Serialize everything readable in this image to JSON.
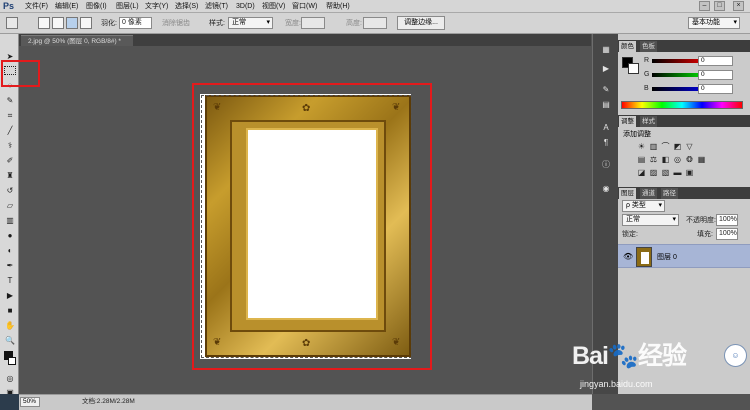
{
  "menubar": {
    "logo": "Ps",
    "items": [
      "文件(F)",
      "编辑(E)",
      "图像(I)",
      "图层(L)",
      "文字(Y)",
      "选择(S)",
      "滤镜(T)",
      "3D(D)",
      "视图(V)",
      "窗口(W)",
      "帮助(H)"
    ],
    "window_controls": [
      "–",
      "□",
      "×"
    ]
  },
  "options": {
    "feather_label": "羽化:",
    "feather_value": "0 像素",
    "antialias_label": "消除锯齿",
    "style_label": "样式:",
    "style_value": "正常",
    "width_label": "宽度:",
    "height_label": "高度:",
    "refine_button": "调整边缘...",
    "workspace_value": "基本功能"
  },
  "document": {
    "tab_label": "2.jpg @ 50% (图层 0, RGB/8#) *"
  },
  "status": {
    "zoom": "50%",
    "doc_info": "文档:2.28M/2.28M"
  },
  "panels": {
    "color_tabs": [
      "颜色",
      "色板"
    ],
    "channel_labels": [
      "R",
      "G",
      "B"
    ],
    "channel_values": [
      "0",
      "0",
      "0"
    ],
    "adjustments_tabs": [
      "调整",
      "样式"
    ],
    "adjustments_title": "添加调整",
    "layers_tabs": [
      "图层",
      "通道",
      "路径"
    ],
    "kind_label": "ρ 类型",
    "blend_mode": "正常",
    "opacity_label": "不透明度:",
    "opacity_value": "100%",
    "lock_label": "锁定:",
    "fill_label": "填充:",
    "fill_value": "100%",
    "layer_name": "图层 0"
  },
  "watermark": {
    "brand": "Bai🐾经验",
    "url": "jingyan.baidu.com"
  },
  "colors": {
    "highlight": "#e31a1c",
    "frame_gold": "#c79d2d",
    "selected_layer": "#a7b5d6"
  }
}
